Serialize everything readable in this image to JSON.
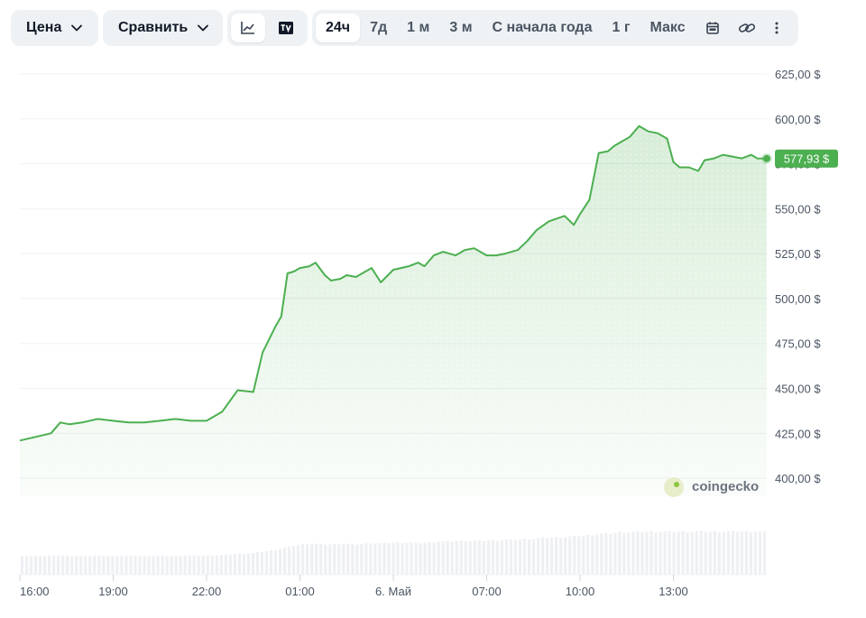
{
  "toolbar": {
    "price_label": "Цена",
    "compare_label": "Сравнить",
    "ranges": [
      "24ч",
      "7д",
      "1 м",
      "3 м",
      "С начала года",
      "1 г",
      "Макс"
    ],
    "active_range": "24ч",
    "icons": [
      "line-chart-icon",
      "tradingview-icon",
      "calendar-icon",
      "link-icon",
      "more-vertical-icon"
    ]
  },
  "watermark": "coingecko",
  "colors": {
    "line": "#4caf50",
    "badge": "#4caf50",
    "grid": "#eff2f5",
    "axis_text": "#4b5563"
  },
  "chart_data": {
    "type": "area",
    "current_price_label": "577,93 $",
    "y_ticks": [
      "625,00 $",
      "600,00 $",
      "575,00 $",
      "550,00 $",
      "525,00 $",
      "500,00 $",
      "475,00 $",
      "450,00 $",
      "425,00 $",
      "400,00 $"
    ],
    "y_tick_values": [
      625,
      600,
      575,
      550,
      525,
      500,
      475,
      450,
      425,
      400
    ],
    "x_ticks": [
      "16:00",
      "19:00",
      "22:00",
      "01:00",
      "6. Май",
      "07:00",
      "10:00",
      "13:00"
    ],
    "x_tick_hours": [
      0,
      3,
      6,
      9,
      12,
      15,
      18,
      21
    ],
    "ylim": [
      390,
      630
    ],
    "xlim_hours": [
      0,
      24
    ],
    "series": [
      {
        "hours": [
          0,
          0.5,
          1,
          1.3,
          1.6,
          2,
          2.5,
          3,
          3.5,
          4,
          4.5,
          5,
          5.5,
          6,
          6.5,
          7,
          7.5,
          7.8,
          8.2,
          8.4,
          8.6,
          8.8,
          9,
          9.3,
          9.5,
          9.8,
          10,
          10.3,
          10.5,
          10.8,
          11,
          11.3,
          11.6,
          12,
          12.5,
          12.8,
          13,
          13.3,
          13.6,
          14,
          14.3,
          14.6,
          15,
          15.3,
          15.6,
          16,
          16.3,
          16.6,
          17,
          17.5,
          17.8,
          18,
          18.3,
          18.6,
          18.9,
          19.1,
          19.3,
          19.6,
          19.9,
          20.2,
          20.5,
          20.8,
          21,
          21.2,
          21.5,
          21.8,
          22,
          22.3,
          22.6,
          22.9,
          23.2,
          23.5,
          23.7,
          24
        ],
        "values": [
          421,
          423,
          425,
          431,
          430,
          431,
          433,
          432,
          431,
          431,
          432,
          433,
          432,
          432,
          437,
          449,
          448,
          470,
          484,
          490,
          514,
          515,
          517,
          518,
          520,
          513,
          510,
          511,
          513,
          512,
          514,
          517,
          509,
          516,
          518,
          520,
          518,
          524,
          526,
          524,
          527,
          528,
          524,
          524,
          525,
          527,
          532,
          538,
          543,
          546,
          541,
          547,
          555,
          581,
          582,
          585,
          587,
          590,
          596,
          593,
          592,
          589,
          576,
          573,
          573,
          571,
          577,
          578,
          580,
          579,
          578,
          580,
          578,
          577.93
        ],
        "volume_rel": [
          0.3,
          0.3,
          0.31,
          0.31,
          0.3,
          0.3,
          0.31,
          0.3,
          0.31,
          0.3,
          0.31,
          0.3,
          0.31,
          0.31,
          0.32,
          0.34,
          0.35,
          0.37,
          0.4,
          0.42,
          0.44,
          0.47,
          0.49,
          0.5,
          0.5,
          0.49,
          0.49,
          0.5,
          0.5,
          0.49,
          0.5,
          0.51,
          0.51,
          0.52,
          0.52,
          0.51,
          0.52,
          0.53,
          0.54,
          0.54,
          0.55,
          0.55,
          0.55,
          0.56,
          0.57,
          0.57,
          0.58,
          0.59,
          0.6,
          0.61,
          0.62,
          0.63,
          0.64,
          0.66,
          0.67,
          0.68,
          0.69,
          0.69,
          0.7,
          0.7,
          0.7,
          0.7,
          0.7,
          0.7,
          0.7,
          0.7,
          0.7,
          0.7,
          0.7,
          0.7,
          0.7,
          0.7,
          0.7,
          0.7
        ]
      }
    ],
    "grid": true
  }
}
